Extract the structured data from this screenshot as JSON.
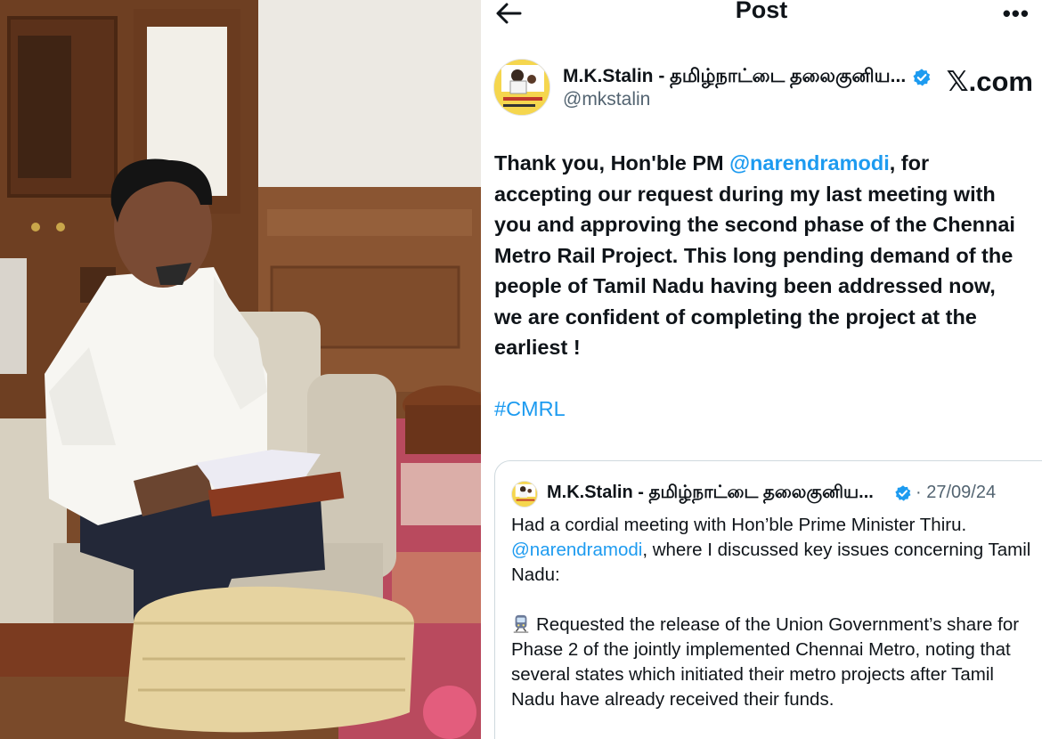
{
  "header": {
    "title": "Post",
    "back_icon": "arrow-left-icon",
    "more_label": "•••"
  },
  "author": {
    "display_name": "M.K.Stalin - தமிழ்நாட்டை தலைகுனிய...",
    "handle": "@mkstalin",
    "verified_icon": "verified-badge-icon",
    "verified_color": "#1d9bf0"
  },
  "watermark": {
    "x_mark": "𝕏",
    "domain": ".com"
  },
  "tweet": {
    "text_1": "Thank you, Hon'ble PM ",
    "mention": "@narendramodi",
    "text_2": ", for accepting our request during my last meeting with you and approving the second phase of the Chennai Metro Rail Project. This long pending demand of the people of Tamil Nadu having been addressed now, we are confident of completing the project at the earliest !",
    "hashtag": "#CMRL"
  },
  "quoted_post": {
    "display_name": "M.K.Stalin - தமிழ்நாட்டை தலைகுனிய...",
    "date": "· 27/09/24",
    "text_1": "Had a cordial meeting with Hon’ble Prime Minister Thiru.",
    "mention": "@narendramodi",
    "text_2": ", where I discussed key issues concerning Tamil Nadu:",
    "bullet_icon": "metro-train-icon",
    "bullet_text": "Requested the release of the Union Government’s share for Phase 2 of the jointly implemented Chennai Metro, noting that several states which initiated their metro projects after Tamil Nadu have already received their funds."
  },
  "colors": {
    "link": "#1d9bf0",
    "secondary_text": "#536471",
    "primary_text": "#0f1419",
    "border": "#cfd9de"
  }
}
